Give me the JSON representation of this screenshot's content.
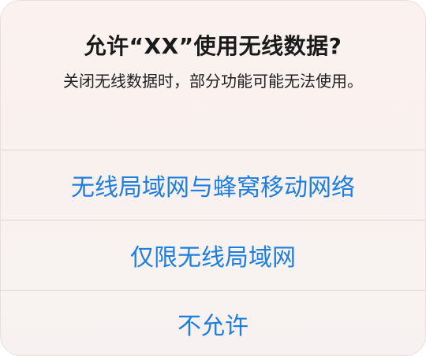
{
  "alert": {
    "title": "允许“XX”使用无线数据?",
    "message": "关闭无线数据时，部分功能可能无法使用。",
    "actions": [
      {
        "label": "无线局域网与蜂窝移动网络"
      },
      {
        "label": "仅限无线局域网"
      },
      {
        "label": "不允许"
      }
    ],
    "action_color": "#1e7ee0"
  }
}
